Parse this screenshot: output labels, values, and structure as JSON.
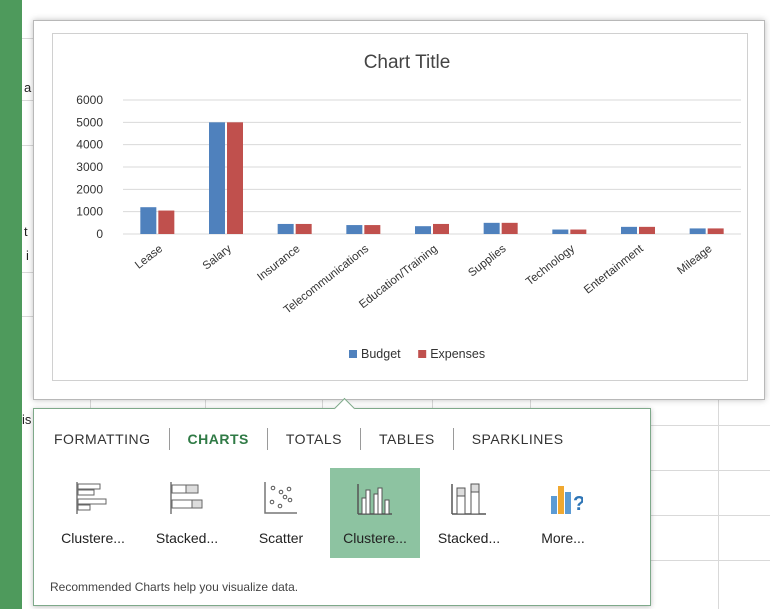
{
  "sheet": {
    "fragments": [
      "a",
      "t",
      "i",
      "is"
    ]
  },
  "chart_preview": {
    "chart_data": {
      "type": "bar",
      "title": "Chart Title",
      "categories": [
        "Lease",
        "Salary",
        "Insurance",
        "Telecommunications",
        "Education/Training",
        "Supplies",
        "Technology",
        "Entertainment",
        "Mileage"
      ],
      "series": [
        {
          "name": "Budget",
          "color": "#4f81bd",
          "values": [
            1200,
            5000,
            450,
            400,
            350,
            500,
            200,
            320,
            250
          ]
        },
        {
          "name": "Expenses",
          "color": "#c0504d",
          "values": [
            1050,
            5000,
            450,
            400,
            450,
            500,
            200,
            320,
            250
          ]
        }
      ],
      "yticks": [
        "0",
        "1000",
        "2000",
        "3000",
        "4000",
        "5000",
        "6000"
      ],
      "ylim": [
        0,
        6000
      ],
      "grid": true,
      "legend": "bottom"
    }
  },
  "quick_analysis": {
    "tabs": [
      {
        "label": "FORMATTING",
        "active": false
      },
      {
        "label": "CHARTS",
        "active": true
      },
      {
        "label": "TOTALS",
        "active": false
      },
      {
        "label": "TABLES",
        "active": false
      },
      {
        "label": "SPARKLINES",
        "active": false
      }
    ],
    "tiles": [
      {
        "label": "Clustere...",
        "icon": "clustered-bar-icon",
        "selected": false
      },
      {
        "label": "Stacked...",
        "icon": "stacked-bar-icon",
        "selected": false
      },
      {
        "label": "Scatter",
        "icon": "scatter-icon",
        "selected": false
      },
      {
        "label": "Clustere...",
        "icon": "clustered-column-icon",
        "selected": true
      },
      {
        "label": "Stacked...",
        "icon": "stacked-column-icon",
        "selected": false
      },
      {
        "label": "More...",
        "icon": "more-charts-icon",
        "selected": false
      }
    ],
    "footer": "Recommended Charts help you visualize data.",
    "accent": "#2f7a45",
    "selected_bg": "#8dc3a1"
  }
}
